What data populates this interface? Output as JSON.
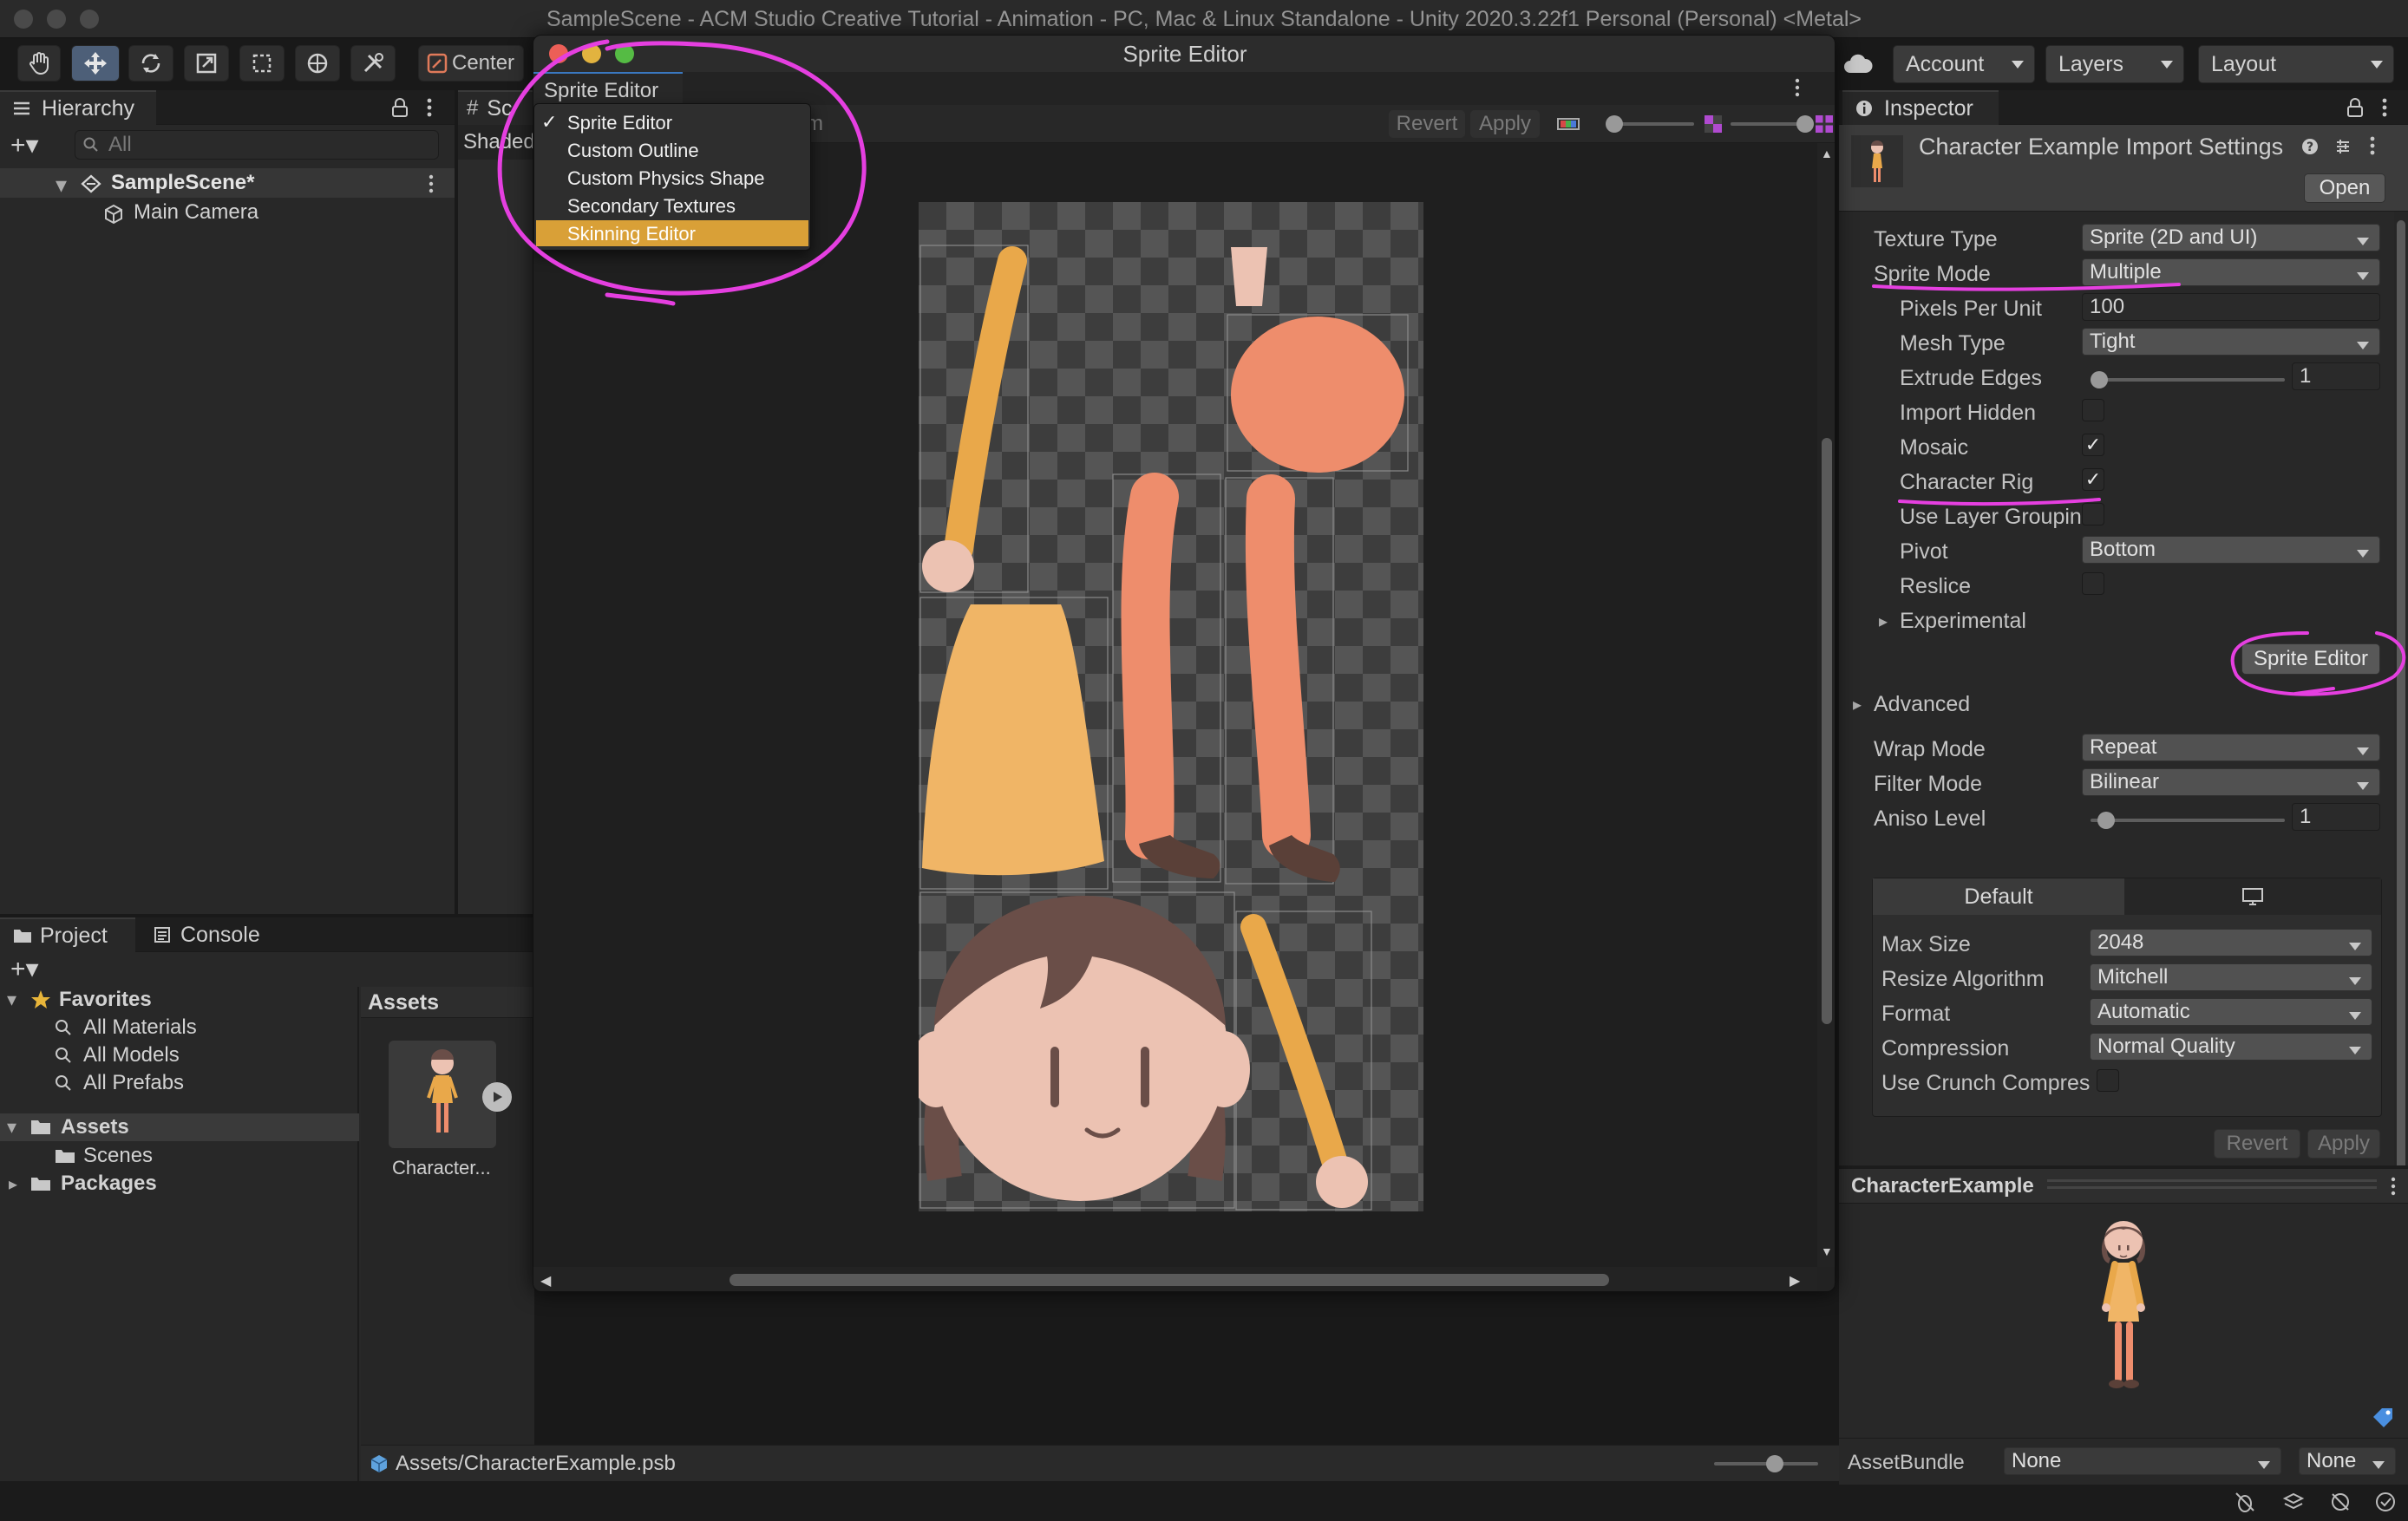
{
  "window_title": "SampleScene - ACM Studio Creative Tutorial - Animation - PC, Mac & Linux Standalone - Unity 2020.3.22f1 Personal (Personal) <Metal>",
  "toolbar": {
    "pivot_label": "Center",
    "account_label": "Account",
    "layers_label": "Layers",
    "layout_label": "Layout"
  },
  "hierarchy": {
    "tab": "Hierarchy",
    "search_placeholder": "All",
    "scene": "SampleScene*",
    "items": [
      "Main Camera"
    ]
  },
  "scene_view": {
    "tab": "Sc",
    "shading": "Shaded"
  },
  "sprite_editor": {
    "title": "Sprite Editor",
    "mode_dropdown": "Sprite Editor",
    "menu": [
      {
        "label": "Sprite Editor",
        "checked": true
      },
      {
        "label": "Custom Outline",
        "checked": false
      },
      {
        "label": "Custom Physics Shape",
        "checked": false
      },
      {
        "label": "Secondary Textures",
        "checked": false
      },
      {
        "label": "Skinning Editor",
        "checked": false,
        "highlighted": true
      }
    ],
    "hidden_text": "m",
    "revert": "Revert",
    "apply": "Apply"
  },
  "project": {
    "tab_project": "Project",
    "tab_console": "Console",
    "favorites": "Favorites",
    "favorite_items": [
      "All Materials",
      "All Models",
      "All Prefabs"
    ],
    "assets_folder": "Assets",
    "asset_children": [
      "Scenes"
    ],
    "packages": "Packages",
    "assets_header": "Assets",
    "asset_tile_label": "Character...",
    "status_path": "Assets/CharacterExample.psb"
  },
  "inspector": {
    "tab": "Inspector",
    "header_title": "Character Example Import Settings",
    "open_button": "Open",
    "rows": {
      "texture_type": {
        "label": "Texture Type",
        "value": "Sprite (2D and UI)"
      },
      "sprite_mode": {
        "label": "Sprite Mode",
        "value": "Multiple"
      },
      "pixels_per_unit": {
        "label": "Pixels Per Unit",
        "value": "100"
      },
      "mesh_type": {
        "label": "Mesh Type",
        "value": "Tight"
      },
      "extrude_edges": {
        "label": "Extrude Edges",
        "value": "1"
      },
      "import_hidden": {
        "label": "Import Hidden"
      },
      "mosaic": {
        "label": "Mosaic"
      },
      "character_rig": {
        "label": "Character Rig"
      },
      "use_layer_grouping": {
        "label": "Use Layer Groupin"
      },
      "pivot": {
        "label": "Pivot",
        "value": "Bottom"
      },
      "reslice": {
        "label": "Reslice"
      },
      "experimental": {
        "label": "Experimental"
      }
    },
    "sprite_editor_button": "Sprite Editor",
    "advanced": "Advanced",
    "wrap_mode": {
      "label": "Wrap Mode",
      "value": "Repeat"
    },
    "filter_mode": {
      "label": "Filter Mode",
      "value": "Bilinear"
    },
    "aniso_level": {
      "label": "Aniso Level",
      "value": "1"
    },
    "platform_tab_default": "Default",
    "max_size": {
      "label": "Max Size",
      "value": "2048"
    },
    "resize_algorithm": {
      "label": "Resize Algorithm",
      "value": "Mitchell"
    },
    "format": {
      "label": "Format",
      "value": "Automatic"
    },
    "compression": {
      "label": "Compression",
      "value": "Normal Quality"
    },
    "use_crunch": {
      "label": "Use Crunch Compres"
    },
    "revert": "Revert",
    "apply": "Apply",
    "preview_title": "CharacterExample",
    "assetbundle_label": "AssetBundle",
    "assetbundle_value": "None",
    "assetbundle_variant": "None"
  },
  "colors": {
    "annotation": "#e53fe0",
    "menu_highlight": "#d9a037",
    "sprite_orange": "#e9a84a",
    "sprite_peach": "#ee8d6c",
    "sprite_skin": "#ecc2b2",
    "sprite_hair": "#6a4e48"
  },
  "icons": [
    "hand-tool-icon",
    "move-tool-icon",
    "rotate-tool-icon",
    "scale-tool-icon",
    "rect-tool-icon",
    "transform-tool-icon",
    "custom-tool-icon",
    "cloud-icon",
    "lock-icon",
    "kebab-menu-icon",
    "star-icon",
    "folder-icon",
    "search-icon",
    "camera-object-icon",
    "scene-icon",
    "play-icon",
    "monitor-icon",
    "tag-icon"
  ]
}
